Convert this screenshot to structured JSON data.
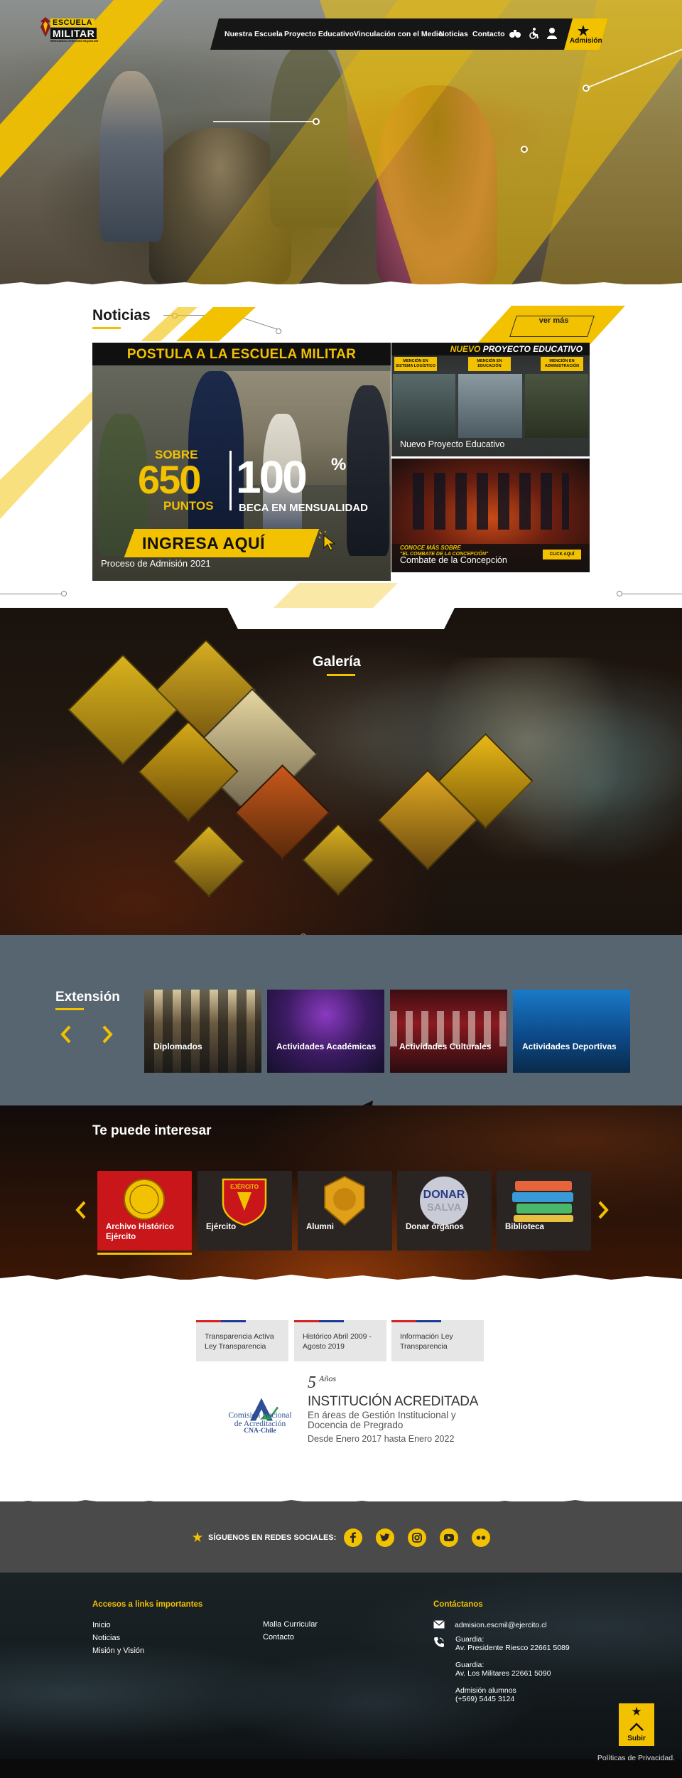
{
  "brand": {
    "logo_line1": "ESCUELA",
    "logo_line2": "MILITAR",
    "logo_line3": "BERNARDO O'HIGGINS RIQUELME",
    "accent": "#f2c100"
  },
  "nav": {
    "items": [
      "Nuestra Escuela",
      "Proyecto Educativo",
      "Vinculación con el Medio",
      "Noticias",
      "Contacto"
    ],
    "icons": [
      "binoculars-icon",
      "accessibility-icon",
      "user-icon"
    ],
    "admision_label": "Admisión"
  },
  "noticias": {
    "title": "Noticias",
    "ver_mas": "ver más",
    "feature": {
      "banner": "POSTULA A LA ESCUELA MILITAR",
      "sobre": "SOBRE",
      "points": "650",
      "puntos": "PUNTOS",
      "beca": "100",
      "pct": "%",
      "beca_label": "BECA EN MENSUALIDAD",
      "cta": "INGRESA AQUÍ",
      "caption": "Proceso de Admisión 2021"
    },
    "side": [
      {
        "head_yellow": "NUEVO",
        "head_white": "PROYECTO EDUCATIVO",
        "tags": [
          "MENCIÓN EN SISTEMA LOGÍSTICO",
          "MENCIÓN EN EDUCACIÓN",
          "MENCIÓN EN ADMINISTRACIÓN"
        ],
        "caption": "Nuevo Proyecto Educativo"
      },
      {
        "conoce": "CONOCE MÁS SOBRE",
        "combate_quote": "\"EL COMBATE DE LA CONCEPCIÓN\"",
        "click": "CLICK AQUÍ",
        "caption": "Combate de la Concepción"
      }
    ]
  },
  "galeria": {
    "title": "Galería"
  },
  "extension": {
    "title": "Extensión",
    "cards": [
      "Diplomados",
      "Actividades Académicas",
      "Actividades Culturales",
      "Actividades Deportivas"
    ]
  },
  "interesar": {
    "title": "Te puede interesar",
    "cards": [
      "Archivo Histórico Ejército",
      "Ejército",
      "Alumni",
      "Donar órganos",
      "Biblioteca"
    ],
    "badge_texts": [
      "EJÉRCITO",
      "DONAR",
      "SALVA"
    ]
  },
  "info_links": [
    "Transparencia Activa Ley Transparencia",
    "Histórico Abril 2009 - Agosto 2019",
    "Información Ley Transparencia"
  ],
  "acreditacion": {
    "cna_name": "Comisión Nacional de Acreditación",
    "cna_short": "CNA-Chile",
    "years": "5",
    "years_label": "Años",
    "title": "INSTITUCIÓN ACREDITADA",
    "areas_line1": "En áreas de Gestión Institucional y",
    "areas_line2": "Docencia de Pregrado",
    "dates": "Desde Enero 2017 hasta Enero 2022"
  },
  "social": {
    "label": "SÍGUENOS EN REDES SOCIALES:",
    "icons": [
      "facebook-icon",
      "twitter-icon",
      "instagram-icon",
      "youtube-icon",
      "flickr-icon"
    ]
  },
  "footer": {
    "links_head": "Accesos a links importantes",
    "col1": [
      "Inicio",
      "Noticias",
      "Misión y Visión"
    ],
    "col2": [
      "Malla Curricular",
      "Contacto"
    ],
    "contact_head": "Contáctanos",
    "email": "admision.escmil@ejercito.cl",
    "guardia1_label": "Guardia:",
    "guardia1": "Av. Presidente Riesco 22661 5089",
    "guardia2_label": "Guardia:",
    "guardia2": "Av. Los Militares 22661 5090",
    "admision_label": "Admisión alumnos",
    "admision_phone": "(+569) 5445 3124",
    "subir": "Subir",
    "privacy": "Políticas de Privacidad."
  }
}
